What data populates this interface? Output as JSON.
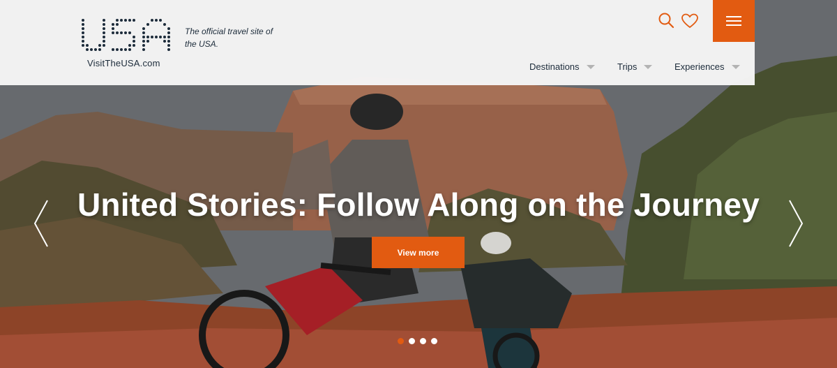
{
  "brand": {
    "logo_text": "USA",
    "url_text": "VisitTheUSA.com",
    "tagline": "The official travel site of the USA."
  },
  "header": {
    "icons": [
      "search-icon",
      "heart-icon",
      "hamburger-menu-icon"
    ],
    "nav": [
      {
        "label": "Destinations"
      },
      {
        "label": "Trips"
      },
      {
        "label": "Experiences"
      }
    ]
  },
  "hero": {
    "headline": "United Stories: Follow Along on the Journey",
    "cta_label": "View more",
    "slides_count": 4,
    "active_slide": 1
  },
  "colors": {
    "accent": "#e25b11",
    "navy": "#1c2b3a",
    "header_bg": "#f6f6f6"
  }
}
